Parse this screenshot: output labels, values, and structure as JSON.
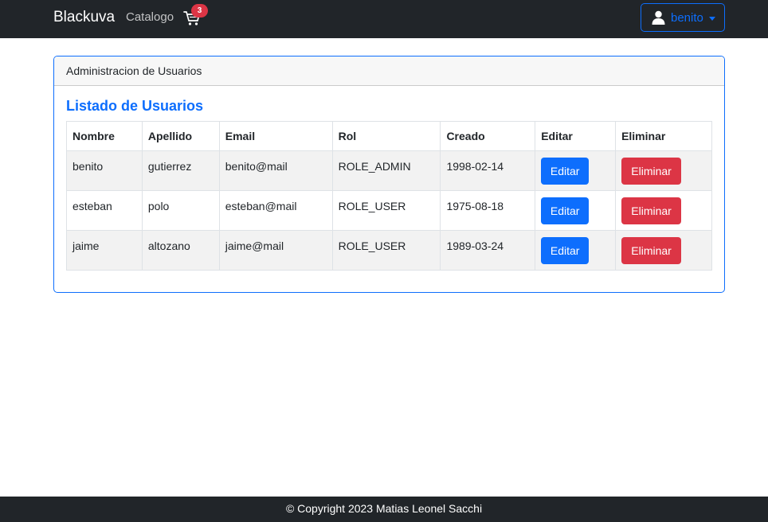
{
  "navbar": {
    "brand": "Blackuva",
    "link_catalogo": "Catalogo",
    "cart_count": "3",
    "user_label": "benito"
  },
  "card": {
    "header": "Administracion de Usuarios",
    "title": "Listado de Usuarios"
  },
  "table": {
    "columns": [
      "Nombre",
      "Apellido",
      "Email",
      "Rol",
      "Creado",
      "Editar",
      "Eliminar"
    ],
    "rows": [
      {
        "nombre": "benito",
        "apellido": "gutierrez",
        "email": "benito@mail",
        "rol": "ROLE_ADMIN",
        "creado": "1998-02-14"
      },
      {
        "nombre": "esteban",
        "apellido": "polo",
        "email": "esteban@mail",
        "rol": "ROLE_USER",
        "creado": "1975-08-18"
      },
      {
        "nombre": "jaime",
        "apellido": "altozano",
        "email": "jaime@mail",
        "rol": "ROLE_USER",
        "creado": "1989-03-24"
      }
    ],
    "edit_label": "Editar",
    "delete_label": "Eliminar"
  },
  "footer": {
    "text": "© Copyright 2023 Matias Leonel Sacchi"
  },
  "colors": {
    "navbar_bg": "#212529",
    "primary": "#0d6efd",
    "danger": "#dc3545"
  }
}
